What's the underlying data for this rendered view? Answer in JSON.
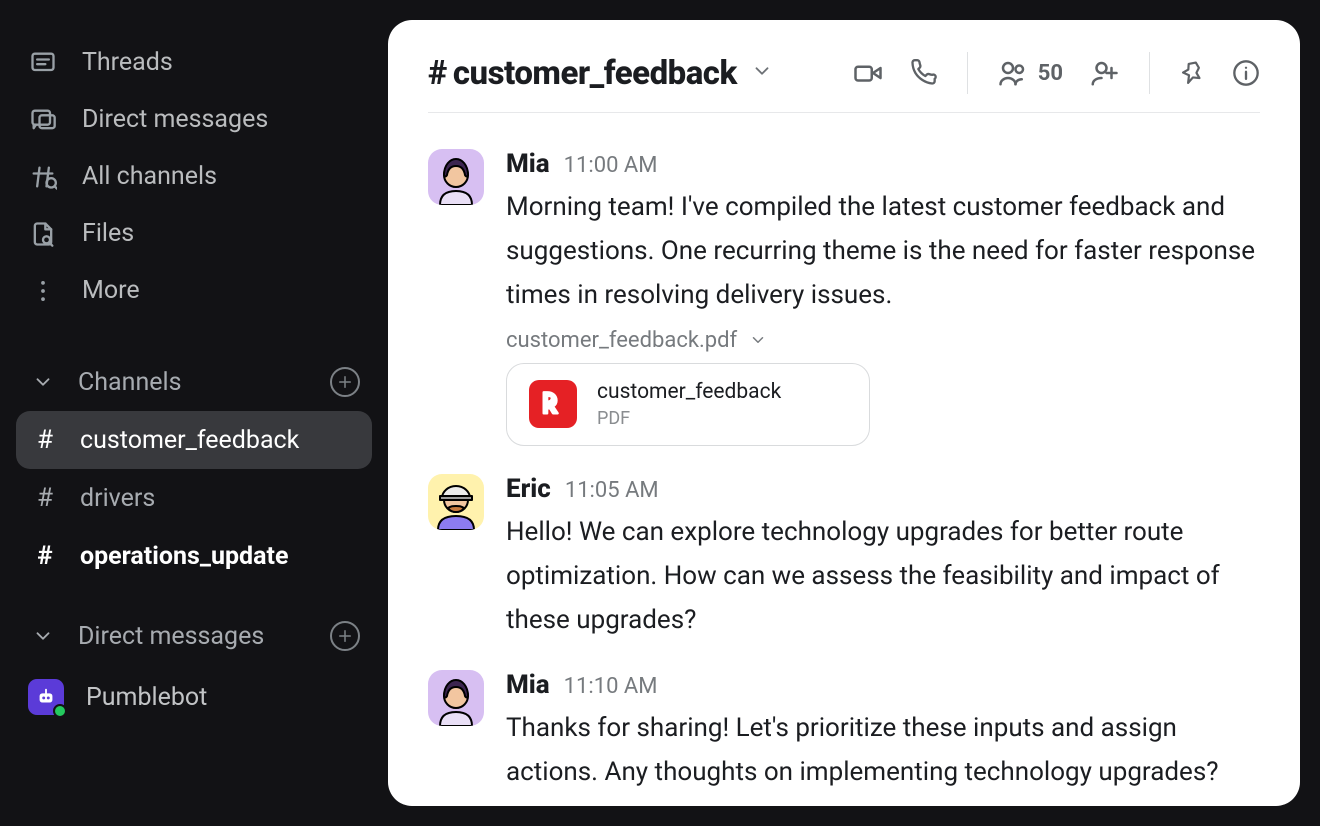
{
  "sidebar": {
    "nav": [
      {
        "key": "threads",
        "label": "Threads"
      },
      {
        "key": "direct-messages",
        "label": "Direct messages"
      },
      {
        "key": "all-channels",
        "label": "All channels"
      },
      {
        "key": "files",
        "label": "Files"
      },
      {
        "key": "more",
        "label": "More"
      }
    ],
    "sections": {
      "channels": {
        "label": "Channels",
        "items": [
          {
            "name": "customer_feedback",
            "active": true,
            "unread": false
          },
          {
            "name": "drivers",
            "active": false,
            "unread": false
          },
          {
            "name": "operations_update",
            "active": false,
            "unread": true
          }
        ]
      },
      "dms": {
        "label": "Direct messages",
        "items": [
          {
            "name": "Pumblebot",
            "online": true
          }
        ]
      }
    }
  },
  "header": {
    "channel_name": "customer_feedback",
    "member_count": "50"
  },
  "messages": [
    {
      "author": "Mia",
      "avatar": "mia",
      "time": "11:00 AM",
      "text": "Morning team! I've compiled the latest customer feedback and suggestions. One recurring theme is the need for faster response times in resolving delivery issues.",
      "attachment": {
        "label": "customer_feedback.pdf",
        "card_name": "customer_feedback",
        "card_type": "PDF"
      }
    },
    {
      "author": "Eric",
      "avatar": "eric",
      "time": "11:05 AM",
      "text": "Hello! We can explore technology upgrades for better route optimization. How can we assess the feasibility and impact of these upgrades?"
    },
    {
      "author": "Mia",
      "avatar": "mia",
      "time": "11:10 AM",
      "text": "Thanks for sharing! Let's prioritize these inputs and assign actions. Any thoughts on implementing technology upgrades?"
    }
  ]
}
